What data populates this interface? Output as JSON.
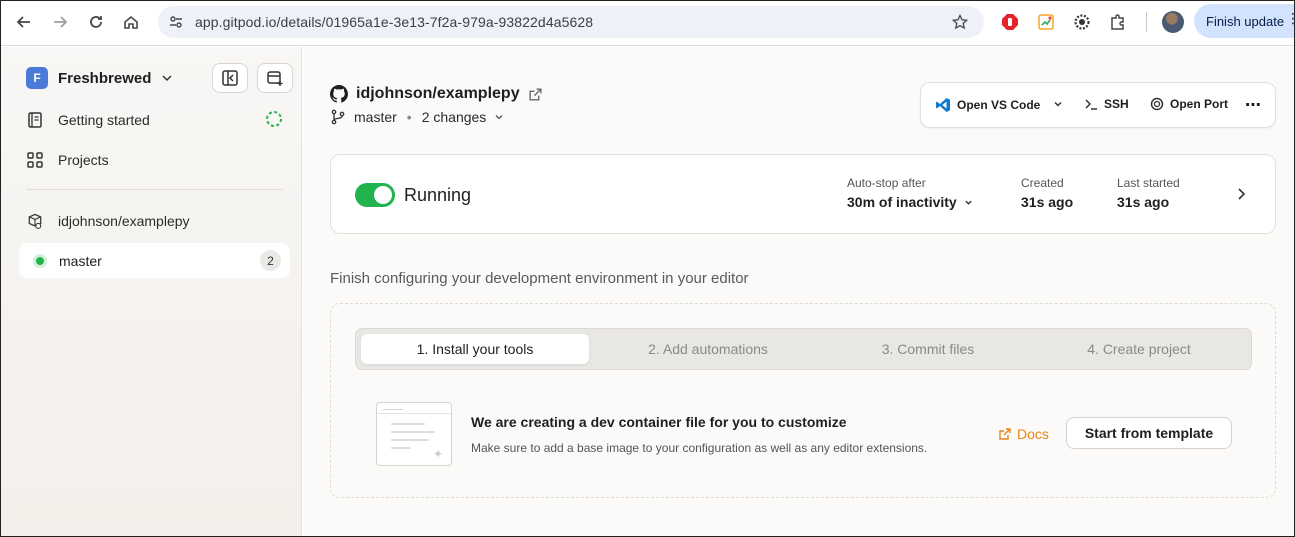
{
  "browser": {
    "url": "app.gitpod.io/details/01965a1e-3e13-7f2a-979a-93822d4a5628",
    "update_label": "Finish update",
    "icons": [
      "back-icon",
      "forward-icon",
      "reload-icon",
      "home-icon",
      "site-info-icon",
      "bookmark-star-icon",
      "extension-icons",
      "profile-avatar",
      "menu-kebab-icon"
    ]
  },
  "sidebar": {
    "org_initial": "F",
    "org_name": "Freshbrewed",
    "items": [
      {
        "label": "Getting started",
        "icon": "book-icon"
      },
      {
        "label": "Projects",
        "icon": "grid-icon"
      }
    ],
    "repo": "idjohnson/examplepy",
    "environment": {
      "branch": "master",
      "count": "2"
    }
  },
  "header": {
    "repo": "idjohnson/examplepy",
    "branch": "master",
    "changes": "2 changes"
  },
  "toolbar": {
    "open_vscode": "Open VS Code",
    "ssh": "SSH",
    "open_port": "Open Port"
  },
  "status": {
    "state": "Running",
    "autostop_label": "Auto-stop after",
    "autostop_value": "30m of inactivity",
    "created_label": "Created",
    "created_value": "31s ago",
    "last_started_label": "Last started",
    "last_started_value": "31s ago"
  },
  "setup": {
    "title": "Finish configuring your development environment in your editor",
    "steps": [
      "1. Install your tools",
      "2. Add automations",
      "3. Commit files",
      "4. Create project"
    ],
    "active_step": 0,
    "task_title": "We are creating a dev container file for you to customize",
    "task_desc": "Make sure to add a base image to your configuration as well as any editor extensions.",
    "docs_label": "Docs",
    "template_button": "Start from template"
  },
  "colors": {
    "accent_green": "#22b34e",
    "docs_orange": "#e6861a",
    "org_badge": "#4b7ad9"
  }
}
